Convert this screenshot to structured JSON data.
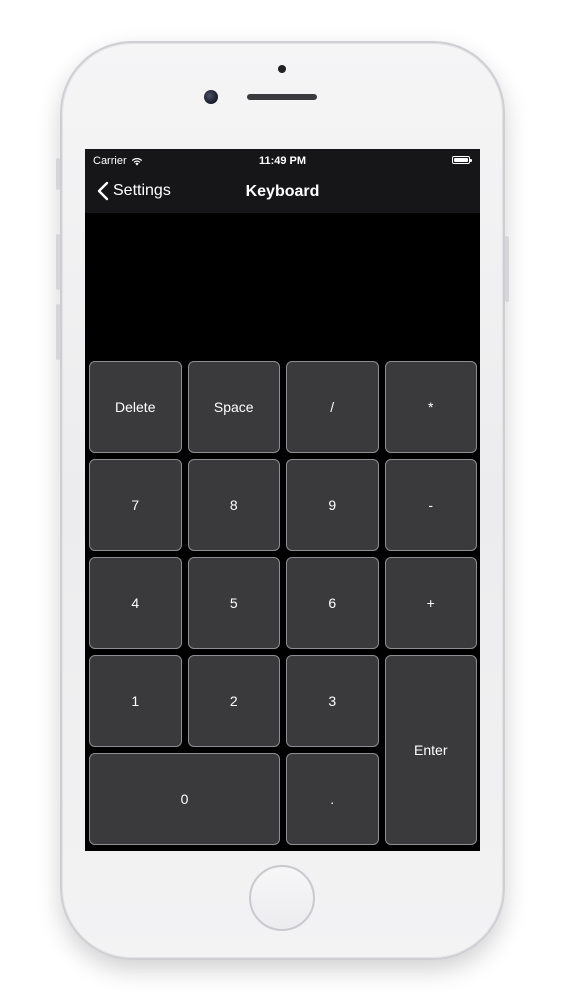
{
  "status_bar": {
    "carrier": "Carrier",
    "time": "11:49 PM",
    "wifi_icon": "wifi-icon",
    "battery_icon": "battery-icon"
  },
  "nav": {
    "back_label": "Settings",
    "back_icon": "chevron-left-icon",
    "title": "Keyboard"
  },
  "keypad": {
    "delete": "Delete",
    "space": "Space",
    "divide": "/",
    "multiply": "*",
    "seven": "7",
    "eight": "8",
    "nine": "9",
    "minus": "-",
    "four": "4",
    "five": "5",
    "six": "6",
    "plus": "+",
    "one": "1",
    "two": "2",
    "three": "3",
    "enter": "Enter",
    "zero": "0",
    "dot": "."
  },
  "colors": {
    "screen_background": "#000000",
    "bar_background": "#161618",
    "key_background": "#3a3a3c",
    "key_border": "#8e8e92",
    "text": "#ffffff"
  }
}
